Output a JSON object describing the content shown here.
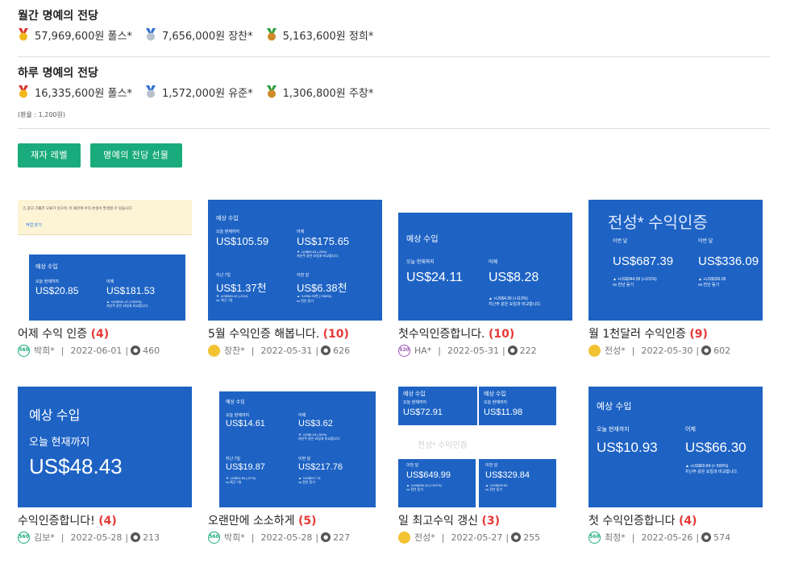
{
  "monthly": {
    "title": "월간 명예의 전당",
    "entries": [
      {
        "medal": "gold",
        "text": "57,969,600원 폴스*"
      },
      {
        "medal": "silver",
        "text": "7,656,000원 장찬*"
      },
      {
        "medal": "bronze",
        "text": "5,163,600원 정희*"
      }
    ]
  },
  "daily": {
    "title": "하루 명예의 전당",
    "entries": [
      {
        "medal": "gold",
        "text": "16,335,600원 폴스*"
      },
      {
        "medal": "silver",
        "text": "1,572,000원 유준*"
      },
      {
        "medal": "bronze",
        "text": "1,306,800원 주창*"
      }
    ]
  },
  "rate_note": "(환율 : 1,200원)",
  "buttons": {
    "level": "재자 레벨",
    "hall_gift": "명예의 전당 선물"
  },
  "colors": {
    "accent": "#1aab7c",
    "count_red": "#e53935",
    "card_blue": "#1e63c4"
  },
  "posts": [
    {
      "title": "어제 수익 인증 ",
      "count": "(4)",
      "level": "560",
      "author": "박희*",
      "date": "2022-06-01",
      "views": "460",
      "thumb": {
        "banner": "⚠ 광고 크롤러 오류가 있으며, 이 때문에 수익 손실이 발생할 수 있습니다.",
        "banner_links": "작업   닫기",
        "h": "예상 수입",
        "l1": "오늘 현재까지",
        "v1": "US$20.85",
        "l2": "어제",
        "v2": "US$181.53",
        "n2": "▲ +US$161.47 (+500%)\n지난주 같은 요일과 비교합니다."
      }
    },
    {
      "title": "5월 수익인증 해봅니다. ",
      "count": "(10)",
      "level": "",
      "author": "장찬*",
      "date": "2022-05-31",
      "views": "626",
      "thumb": {
        "h": "예상 수입",
        "l1": "오늘 현재까지",
        "v1": "US$105.59",
        "l2": "어제",
        "v2": "US$175.65",
        "n2": "▼ -US$59.63 (-25%)\n지난주 같은 요일과 비교합니다.",
        "l3": "지난 7일",
        "v3": "US$1.37천",
        "n3": "▼ -US$363.42 (-21%)\nvs. 최근 7일",
        "l4": "이번 달",
        "v4": "US$6.38천",
        "n4": "▲ +US$4.99천 (+356%)\nvs 전년 동기"
      }
    },
    {
      "title": "첫수익인증합니다. ",
      "count": "(10)",
      "level": "530",
      "author": "HA*",
      "date": "2022-05-31",
      "views": "222",
      "thumb": {
        "h": "예상 수입",
        "l1": "오늘 현재까지",
        "v1": "US$24.11",
        "l2": "어제",
        "v2": "US$8.28",
        "n2": "▲ +US$4.39 (+113%)\n지난주 같은 요일과 비교합니다."
      }
    },
    {
      "title": "월 1천달러 수익인증 ",
      "count": "(9)",
      "level": "",
      "author": "전성*",
      "date": "2022-05-30",
      "views": "602",
      "thumb": {
        "big": "전성* 수익인증",
        "l1": "이번 달",
        "v1": "US$687.39",
        "n1": "▲ +US$344.59 (+101%)\nvs 전년 동기",
        "l2": "이번 달",
        "v2": "US$336.09",
        "n2": "▲ +US$336.09\nvs 전년 동기"
      }
    },
    {
      "title": "수익인증합니다! ",
      "count": "(4)",
      "level": "560",
      "author": "김보*",
      "date": "2022-05-28",
      "views": "213",
      "thumb": {
        "h": "예상 수입",
        "l1": "오늘 현재까지",
        "v1": "US$48.43"
      }
    },
    {
      "title": "오랜만에 소소하게 ",
      "count": "(5)",
      "level": "560",
      "author": "박희*",
      "date": "2022-05-28",
      "views": "227",
      "thumb": {
        "h": "예상 수입",
        "l1": "오늘 현재까지",
        "v1": "US$14.61",
        "l2": "어제",
        "v2": "US$3.62",
        "n2": "▼ -US$4.18 (-54%)\n지난주 같은 요일과 비교합니다.",
        "l3": "지난 7일",
        "v3": "US$19.87",
        "n3": "▼ -US$11.83 (-37%)\nvs 최근 7일",
        "l4": "이번 달",
        "v4": "US$217.76",
        "n4": "▲ +US$217.76\nvs 전년 동기"
      }
    },
    {
      "title": "일 최고수익 갱신 ",
      "count": "(3)",
      "level": "",
      "author": "전성*",
      "date": "2022-05-27",
      "views": "255",
      "thumb": {
        "h": "예상 수입",
        "l1": "오늘 현재까지",
        "v1": "US$72.91",
        "h2": "예상 수입",
        "l2": "오늘 현재까지",
        "v2": "US$11.98",
        "big": "전성* 수익인증",
        "l3": "이번 달",
        "v3": "US$649.99",
        "n3": "▲ +US$336.10 (+107%)\nvs 전년 동기",
        "l4": "이번 달",
        "v4": "US$329.84",
        "n4": "▲ +US$329.84\nvs 전년 동기"
      }
    },
    {
      "title": "첫 수익인증합니다 ",
      "count": "(4)",
      "level": "560",
      "author": "최정*",
      "date": "2022-05-26",
      "views": "574",
      "thumb": {
        "h": "예상 수입",
        "l1": "오늘 현재까지",
        "v1": "US$10.93",
        "l2": "어제",
        "v2": "US$66.30",
        "n2": "▲ +US$60.84 (> 500%)\n지난주 같은 요일과 비교합니다."
      }
    }
  ]
}
